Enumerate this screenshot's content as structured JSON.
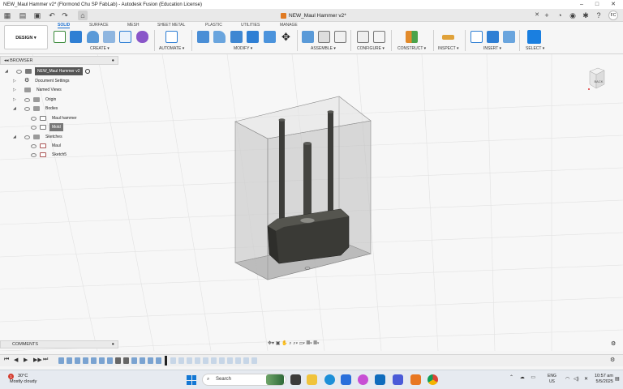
{
  "window": {
    "title": "NEW_Maul Hammer v2* (Flormond Chu SP FabLab) - Autodesk Fusion (Education License)",
    "controls": [
      "–",
      "□",
      "✕"
    ]
  },
  "tabs": {
    "doc_tab_label": "NEW_Maul Hammer v2*",
    "close": "✕",
    "avatar_initials": "FC"
  },
  "toolbar": {
    "workspace_label": "DESIGN ▾",
    "workspace_tabs": [
      "SOLID",
      "SURFACE",
      "MESH",
      "SHEET METAL",
      "PLASTIC",
      "UTILITIES",
      "MANAGE"
    ],
    "active_tab": "SOLID",
    "groups": [
      "CREATE ▾",
      "AUTOMATE ▾",
      "MODIFY ▾",
      "ASSEMBLE ▾",
      "CONFIGURE ▾",
      "CONSTRUCT ▾",
      "INSPECT ▾",
      "INSERT ▾",
      "SELECT ▾"
    ]
  },
  "browser": {
    "title": "BROWSER",
    "tree": [
      {
        "label": "NEW_Maul Hammer v2",
        "level": 0,
        "selected": true,
        "kind": "root"
      },
      {
        "label": "Document Settings",
        "level": 1,
        "kind": "gear"
      },
      {
        "label": "Named Views",
        "level": 1,
        "kind": "folder"
      },
      {
        "label": "Origin",
        "level": 1,
        "kind": "folder"
      },
      {
        "label": "Bodies",
        "level": 1,
        "kind": "folder"
      },
      {
        "label": "Maul hammer",
        "level": 2,
        "kind": "body"
      },
      {
        "label": "Mold",
        "level": 2,
        "kind": "body",
        "highlight": true
      },
      {
        "label": "Sketches",
        "level": 1,
        "kind": "folder"
      },
      {
        "label": "Maul",
        "level": 2,
        "kind": "sketch"
      },
      {
        "label": "Sketch5",
        "level": 2,
        "kind": "sketch"
      }
    ]
  },
  "viewcube": {
    "face_label": "BACK"
  },
  "comments": {
    "title": "COMMENTS"
  },
  "taskbar": {
    "weather_temp": "30°C",
    "weather_desc": "Mostly cloudy",
    "weather_badge": "1",
    "search_placeholder": "Search",
    "lang_line1": "ENG",
    "lang_line2": "US",
    "time": "10:57 am",
    "date": "5/5/2025"
  },
  "colors": {
    "accent": "#1a6fd0",
    "mold_fill": "#c8c8c8",
    "hammer": "#3d3d3a"
  }
}
